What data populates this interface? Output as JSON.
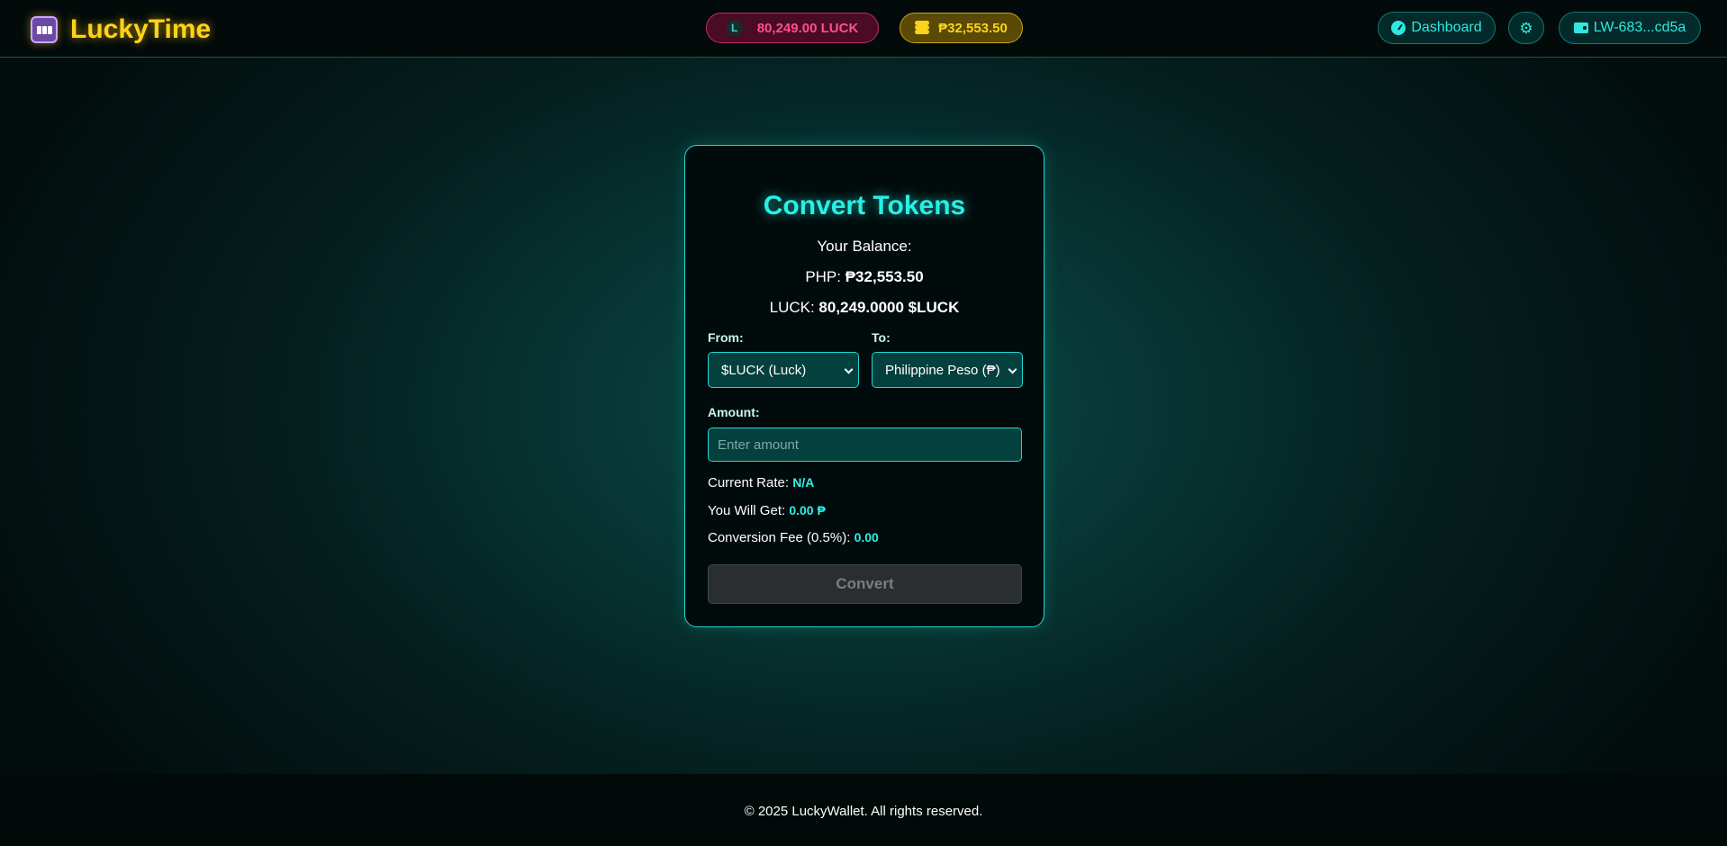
{
  "header": {
    "brand_name": "LuckyTime",
    "brand_icon": "slot-machine-icon",
    "luck_balance_pill": "80,249.00 LUCK",
    "luck_coin_glyph": "L",
    "php_balance_pill": "₱32,553.50",
    "dashboard_label": "Dashboard",
    "settings_glyph": "⚙",
    "wallet_label": "LW-683...cd5a"
  },
  "card": {
    "title": "Convert Tokens",
    "balance_label": "Your Balance:",
    "php_prefix": "PHP: ",
    "php_value": "₱32,553.50",
    "luck_prefix": "LUCK: ",
    "luck_value": "80,249.0000 $LUCK",
    "from_label": "From:",
    "from_selected": "$LUCK (Luck)",
    "to_label": "To:",
    "to_selected": "Philippine Peso (₱)",
    "amount_label": "Amount:",
    "amount_placeholder": "Enter amount",
    "amount_value": "",
    "rate_label": "Current Rate: ",
    "rate_value": "N/A",
    "get_label": "You Will Get: ",
    "get_value": "0.00 ₱",
    "fee_label": "Conversion Fee (0.5%): ",
    "fee_value": "0.00",
    "convert_button": "Convert"
  },
  "footer": {
    "copyright": "© 2025 LuckyWallet. All rights reserved."
  },
  "colors": {
    "accent": "#27f0e6",
    "brand": "#ffd21a",
    "luck_pill": "#ff4f92"
  }
}
